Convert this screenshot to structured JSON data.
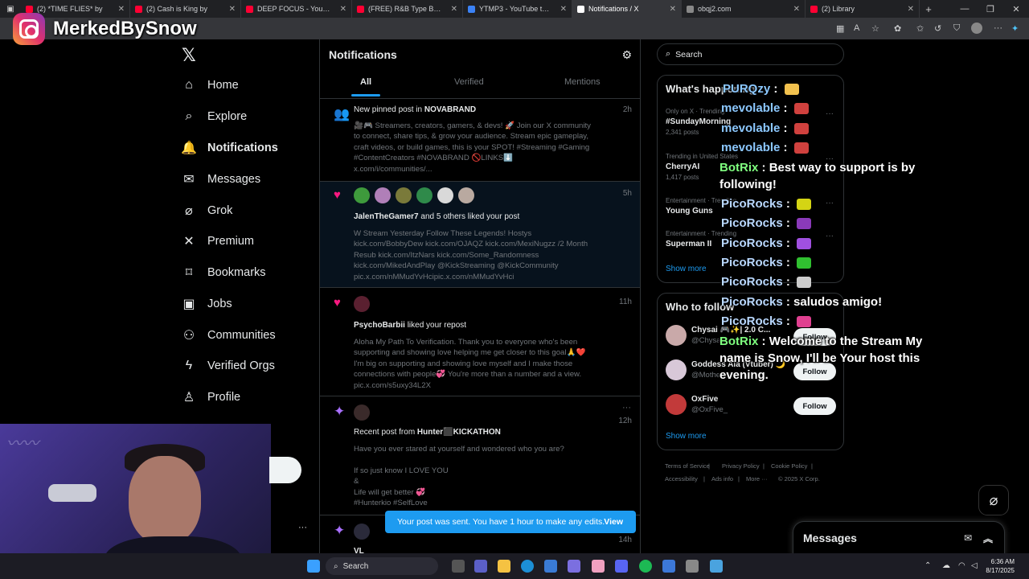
{
  "browser": {
    "tabs": [
      {
        "label": "(2) *TIME FLIES* by",
        "color": "#ff0033",
        "active": false
      },
      {
        "label": "(2) Cash is King by",
        "color": "#ff0033",
        "active": false
      },
      {
        "label": "DEEP FOCUS - YouTube",
        "color": "#ff0033",
        "active": false
      },
      {
        "label": "(FREE) R&B Type Beat - \"Li",
        "color": "#ff0033",
        "active": false
      },
      {
        "label": "YTMP3 - YouTube to MP3 C",
        "color": "#3b82f6",
        "active": false
      },
      {
        "label": "Notifications / X",
        "color": "#ffffff",
        "active": true
      },
      {
        "label": "obqj2.com",
        "color": "#888888",
        "active": false
      },
      {
        "label": "(2) Library",
        "color": "#ff0033",
        "active": false
      }
    ]
  },
  "overlay": {
    "instagram_handle": "MerkedBySnow",
    "chat": [
      {
        "user": "PURQzy",
        "sep": ":",
        "msg": ""
      },
      {
        "user": "mevolable",
        "sep": ":",
        "msg": ""
      },
      {
        "user": "mevolable",
        "sep": ":",
        "msg": ""
      },
      {
        "user": "mevolable",
        "sep": ":",
        "msg": ""
      },
      {
        "user": "BotRix",
        "sep": ":",
        "msg": "Best way to support is by"
      },
      {
        "user": "",
        "sep": "",
        "msg": "following!"
      },
      {
        "user": "PicoRocks",
        "sep": ":",
        "msg": ""
      },
      {
        "user": "PicoRocks",
        "sep": ":",
        "msg": ""
      },
      {
        "user": "PicoRocks",
        "sep": ":",
        "msg": ""
      },
      {
        "user": "PicoRocks",
        "sep": ":",
        "msg": ""
      },
      {
        "user": "PicoRocks",
        "sep": ":",
        "msg": ""
      },
      {
        "user": "PicoRocks",
        "sep": ":",
        "msg": "saludos amigo!"
      },
      {
        "user": "PicoRocks",
        "sep": ":",
        "msg": ""
      },
      {
        "user": "BotRix",
        "sep": ":",
        "msg": "Welcome to the Stream My"
      },
      {
        "user": "",
        "sep": "",
        "msg": "name is Snow, I'll be Your host this"
      },
      {
        "user": "",
        "sep": "",
        "msg": "evening."
      }
    ]
  },
  "nav": {
    "items": [
      {
        "label": "Home",
        "icon": "home-icon",
        "glyph": "⌂"
      },
      {
        "label": "Explore",
        "icon": "search-icon",
        "glyph": "⌕"
      },
      {
        "label": "Notifications",
        "icon": "bell-icon",
        "glyph": "🔔"
      },
      {
        "label": "Messages",
        "icon": "mail-icon",
        "glyph": "✉"
      },
      {
        "label": "Grok",
        "icon": "grok-icon",
        "glyph": "⌀"
      },
      {
        "label": "Premium",
        "icon": "x-premium-icon",
        "glyph": "✕"
      },
      {
        "label": "Bookmarks",
        "icon": "bookmark-icon",
        "glyph": "⌑"
      },
      {
        "label": "Jobs",
        "icon": "briefcase-icon",
        "glyph": "▣"
      },
      {
        "label": "Communities",
        "icon": "people-icon",
        "glyph": "⚇"
      },
      {
        "label": "Verified Orgs",
        "icon": "lightning-icon",
        "glyph": "ϟ"
      },
      {
        "label": "Profile",
        "icon": "person-icon",
        "glyph": "♙"
      }
    ]
  },
  "main": {
    "title": "Notifications",
    "tabs": [
      "All",
      "Verified",
      "Mentions"
    ],
    "notifications": [
      {
        "time": "2h",
        "head_prefix": "New pinned post in ",
        "head_bold": "NOVABRAND",
        "head_suffix": "",
        "body": "🎥🎮 Streamers, creators, gamers, & devs! 🚀 Join our X community\nto connect, share tips, & grow your audience. Stream epic gameplay,\ncraft videos, or build games, this is your SPOT! #Streaming #Gaming\n#ContentCreators #NOVABRAND 🚫LINKS⬇️\nx.com/i/communities/..."
      },
      {
        "time": "5h",
        "head_prefix": "",
        "head_bold": "JalenTheGamer7",
        "head_suffix": " and 5 others liked your post",
        "body": "W Stream Yesterday Follow These Legends! Hostys\nkick.com/BobbyDew kick.com/OJAQZ kick.com/MexiNugzz  /2 Month\nResub kick.com/ItzNars  kick.com/Some_Randomness\nkick.com/MikedAndPlay @KickStreaming  @KickCommunity\npic.x.com/nMMudYvHcipic.x.com/nMMudYvHci"
      },
      {
        "time": "11h",
        "head_prefix": "",
        "head_bold": "PsychoBarbii",
        "head_suffix": " liked your repost",
        "body": "Aloha My Path To Verification. Thank you to everyone who's been\nsupporting and showing love helping me get closer to this goal🙏❤️\nI'm big on supporting and showing love myself and I make those\nconnections with people💞 You're more than a number and a view.\npic.x.com/s5uxy34L2X"
      },
      {
        "time": "12h",
        "head_prefix": "Recent post from ",
        "head_bold": "Hunter⬛KICKATHON",
        "head_suffix": "",
        "body": "Have you ever stared at yourself and wondered who you are?\n\nIf so just know I LOVE YOU\n&\nLife will get better 💞\n#Hunterkio #SelfLove"
      },
      {
        "time": "14h",
        "head_prefix": "",
        "head_bold": "VL",
        "head_suffix": "",
        "body": ""
      }
    ],
    "toast": {
      "text": "Your post was sent. You have 1 hour to make any edits.",
      "action": "View"
    }
  },
  "right": {
    "search_placeholder": "Search",
    "happening": {
      "title": "What's happening",
      "trends": [
        {
          "context": "Only on X · Trending",
          "name": "#SundayMorning",
          "posts": "2,341 posts"
        },
        {
          "context": "Trending in United States",
          "name": "CherryAI",
          "posts": "1,417 posts"
        },
        {
          "context": "Entertainment · Trending",
          "name": "Young Guns",
          "posts": ""
        },
        {
          "context": "Entertainment · Trending",
          "name": "Superman II",
          "posts": ""
        }
      ],
      "show_more": "Show more"
    },
    "who_to_follow": {
      "title": "Who to follow",
      "users": [
        {
          "name": "Chysai 🎮✨| 2.0 C...",
          "handle": "@Chysai",
          "button": "Follow"
        },
        {
          "name": "Goddess Aia (Vtuber) 🌙",
          "handle": "@Mother",
          "button": "Follow"
        },
        {
          "name": "OxFive",
          "handle": "@OxFive_",
          "button": "Follow"
        }
      ],
      "show_more": "Show more"
    },
    "footer": {
      "links": [
        "Terms of Service",
        "Privacy Policy",
        "Cookie Policy",
        "Accessibility",
        "Ads info",
        "More ···"
      ],
      "copyright": "© 2025 X Corp."
    },
    "messages_drawer": "Messages"
  },
  "taskbar": {
    "search": "Search",
    "time": "6:36 AM",
    "date": "8/17/2025"
  },
  "colors": {
    "accent": "#1d9bf0",
    "like": "#f91880",
    "border": "#2f3336"
  }
}
